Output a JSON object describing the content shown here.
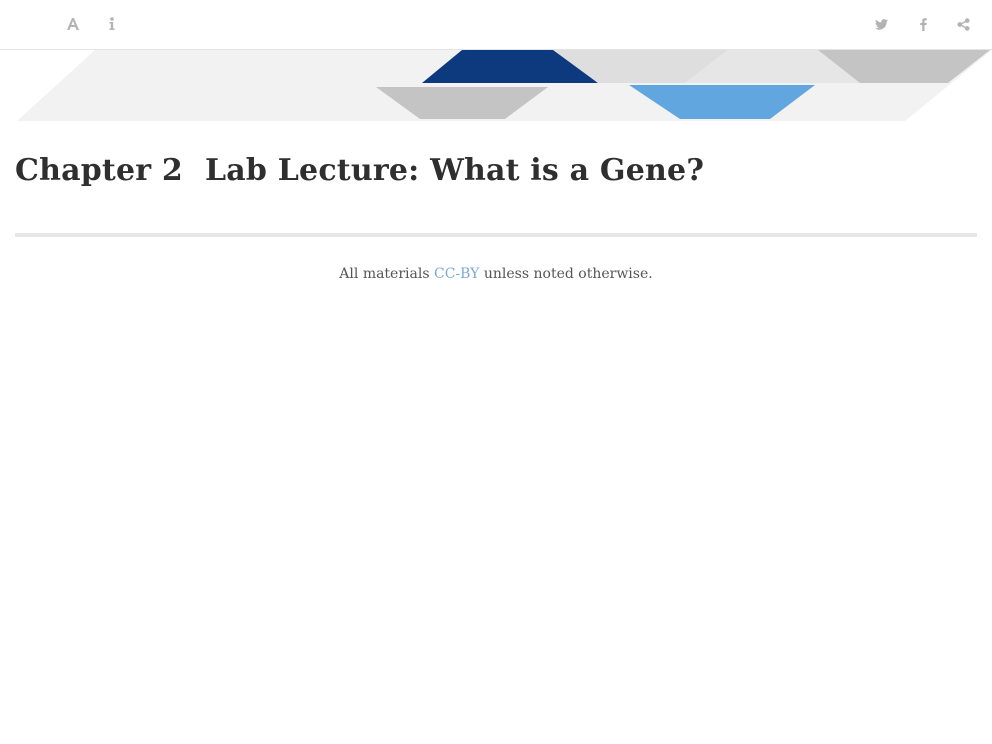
{
  "toolbar": {
    "left_icons": [
      "font-settings-icon",
      "info-icon"
    ],
    "right_icons": [
      "twitter-icon",
      "facebook-icon",
      "share-icon"
    ]
  },
  "colors": {
    "banner_dark_blue": "#0d3a7f",
    "banner_light_blue": "#62a6e0",
    "banner_gray": "#c8c8c8",
    "banner_light_gray": "#f0f0f0",
    "link": "#7aa9d6"
  },
  "chapter": {
    "number_label": "Chapter 2",
    "title": "Lab Lecture: What is a Gene?"
  },
  "footer": {
    "prefix": "All materials ",
    "link_text": "CC-BY",
    "suffix": " unless noted otherwise."
  }
}
